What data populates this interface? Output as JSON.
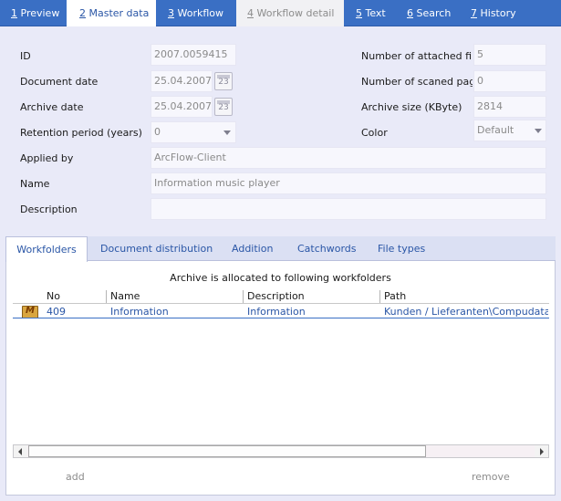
{
  "top_tabs": [
    {
      "num": "1",
      "label": "Preview"
    },
    {
      "num": "2",
      "label": "Master data"
    },
    {
      "num": "3",
      "label": "Workflow"
    },
    {
      "num": "4",
      "label": "Workflow detail"
    },
    {
      "num": "5",
      "label": "Text"
    },
    {
      "num": "6",
      "label": "Search"
    },
    {
      "num": "7",
      "label": "History"
    }
  ],
  "form": {
    "id_label": "ID",
    "id_value": "2007.0059415",
    "document_date_label": "Document date",
    "document_date_value": "25.04.2007",
    "archive_date_label": "Archive date",
    "archive_date_value": "25.04.2007",
    "retention_label": "Retention period (years)",
    "retention_value": "0",
    "applied_by_label": "Applied by",
    "applied_by_value": "ArcFlow-Client",
    "name_label": "Name",
    "name_value": "Information music player",
    "description_label": "Description",
    "description_value": "",
    "attached_files_label": "Number of attached file",
    "attached_files_value": "5",
    "scanned_pages_label": "Number of scaned page",
    "scanned_pages_value": "0",
    "archive_size_label": "Archive size (KByte)",
    "archive_size_value": "2814",
    "color_label": "Color",
    "color_value": "Default",
    "calendar_day": "23"
  },
  "sub_tabs": [
    "Workfolders",
    "Document distribution",
    "Addition",
    "Catchwords",
    "File types"
  ],
  "workfolders": {
    "title": "Archive is allocated to following workfolders",
    "columns": [
      "No",
      "Name",
      "Description",
      "Path"
    ],
    "rows": [
      {
        "icon": "M",
        "no": "409",
        "name": "Information",
        "description": "Information",
        "path": "Kunden / Lieferanten\\Compudata\\I"
      }
    ]
  },
  "buttons": {
    "add": "add",
    "remove": "remove"
  },
  "colors": {
    "accent": "#3a6fc4",
    "background": "#e9eaf8",
    "link_text": "#2a56a6"
  }
}
